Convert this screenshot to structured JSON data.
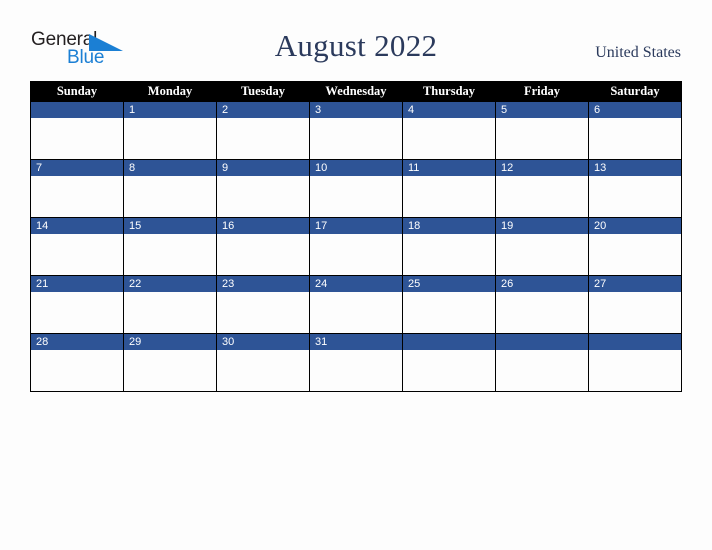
{
  "brand": {
    "name_part1": "General",
    "name_part2": "Blue",
    "triangle_color": "#1b7fd4",
    "text_color": "#231f20"
  },
  "header": {
    "title": "August 2022",
    "country": "United States",
    "title_color": "#2b3a5c"
  },
  "calendar": {
    "weekday_headers": [
      "Sunday",
      "Monday",
      "Tuesday",
      "Wednesday",
      "Thursday",
      "Friday",
      "Saturday"
    ],
    "header_bg": "#000000",
    "header_text_color": "#ffffff",
    "daybar_bg": "#2e5496",
    "daybar_text_color": "#ffffff",
    "cell_bg": "#fdfdfd",
    "border_color": "#000000",
    "weeks": [
      [
        "",
        "1",
        "2",
        "3",
        "4",
        "5",
        "6"
      ],
      [
        "7",
        "8",
        "9",
        "10",
        "11",
        "12",
        "13"
      ],
      [
        "14",
        "15",
        "16",
        "17",
        "18",
        "19",
        "20"
      ],
      [
        "21",
        "22",
        "23",
        "24",
        "25",
        "26",
        "27"
      ],
      [
        "28",
        "29",
        "30",
        "31",
        "",
        "",
        ""
      ]
    ]
  }
}
